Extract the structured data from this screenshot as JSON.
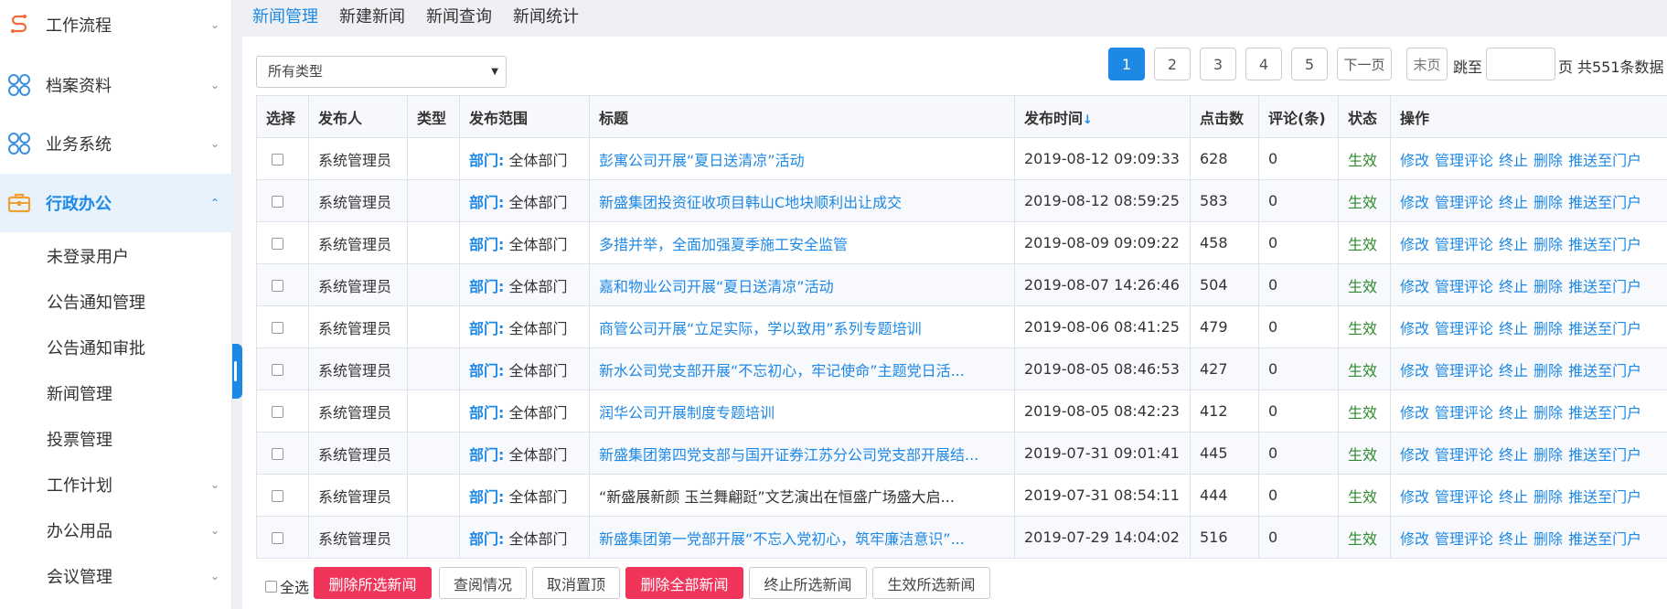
{
  "sidebar": {
    "groups": [
      {
        "label": "工作流程",
        "icon": "workflow-icon"
      },
      {
        "label": "档案资料",
        "icon": "archive-icon"
      },
      {
        "label": "业务系统",
        "icon": "business-system-icon"
      },
      {
        "label": "行政办公",
        "icon": "briefcase-icon"
      }
    ],
    "sub_items": [
      {
        "label": "未登录用户"
      },
      {
        "label": "公告通知管理"
      },
      {
        "label": "公告通知审批"
      },
      {
        "label": "新闻管理"
      },
      {
        "label": "投票管理"
      },
      {
        "label": "工作计划"
      },
      {
        "label": "办公用品"
      },
      {
        "label": "会议管理"
      }
    ]
  },
  "tabs": [
    {
      "label": "新闻管理"
    },
    {
      "label": "新建新闻"
    },
    {
      "label": "新闻查询"
    },
    {
      "label": "新闻统计"
    }
  ],
  "filter": {
    "type_select": "所有类型"
  },
  "pager": {
    "pages": [
      "1",
      "2",
      "3",
      "4",
      "5"
    ],
    "current": "1",
    "next_label": "下一页",
    "last_label": "末页",
    "jump_label": "跳至",
    "page_unit": "页",
    "total_text": "共551条数据"
  },
  "table": {
    "columns": [
      "选择",
      "发布人",
      "类型",
      "发布范围",
      "标题",
      "发布时间",
      "点击数",
      "评论(条)",
      "状态",
      "操作"
    ],
    "sort_indicator": "↓",
    "dept_prefix": "部门:",
    "actions": [
      "修改",
      "管理评论",
      "终止",
      "删除",
      "推送至门户"
    ],
    "rows": [
      {
        "publisher": "系统管理员",
        "type": "",
        "scope": "全体部门",
        "title": "彭寓公司开展“夏日送清凉”活动",
        "time": "2019-08-12 09:09:33",
        "clicks": "628",
        "comments": "0",
        "status": "生效",
        "link": true
      },
      {
        "publisher": "系统管理员",
        "type": "",
        "scope": "全体部门",
        "title": "新盛集团投资征收项目韩山C地块顺利出让成交",
        "time": "2019-08-12 08:59:25",
        "clicks": "583",
        "comments": "0",
        "status": "生效",
        "link": true
      },
      {
        "publisher": "系统管理员",
        "type": "",
        "scope": "全体部门",
        "title": "多措并举，全面加强夏季施工安全监管",
        "time": "2019-08-09 09:09:22",
        "clicks": "458",
        "comments": "0",
        "status": "生效",
        "link": true
      },
      {
        "publisher": "系统管理员",
        "type": "",
        "scope": "全体部门",
        "title": "嘉和物业公司开展“夏日送清凉”活动",
        "time": "2019-08-07 14:26:46",
        "clicks": "504",
        "comments": "0",
        "status": "生效",
        "link": true
      },
      {
        "publisher": "系统管理员",
        "type": "",
        "scope": "全体部门",
        "title": "商管公司开展“立足实际，学以致用”系列专题培训",
        "time": "2019-08-06 08:41:25",
        "clicks": "479",
        "comments": "0",
        "status": "生效",
        "link": true
      },
      {
        "publisher": "系统管理员",
        "type": "",
        "scope": "全体部门",
        "title": "新水公司党支部开展“不忘初心，牢记使命”主题党日活...",
        "time": "2019-08-05 08:46:53",
        "clicks": "427",
        "comments": "0",
        "status": "生效",
        "link": true
      },
      {
        "publisher": "系统管理员",
        "type": "",
        "scope": "全体部门",
        "title": "润华公司开展制度专题培训",
        "time": "2019-08-05 08:42:23",
        "clicks": "412",
        "comments": "0",
        "status": "生效",
        "link": true
      },
      {
        "publisher": "系统管理员",
        "type": "",
        "scope": "全体部门",
        "title": "新盛集团第四党支部与国开证券江苏分公司党支部开展结...",
        "time": "2019-07-31 09:01:41",
        "clicks": "445",
        "comments": "0",
        "status": "生效",
        "link": true
      },
      {
        "publisher": "系统管理员",
        "type": "",
        "scope": "全体部门",
        "title": "“新盛展新颜 玉兰舞翩跹”文艺演出在恒盛广场盛大启...",
        "time": "2019-07-31 08:54:11",
        "clicks": "444",
        "comments": "0",
        "status": "生效",
        "link": false
      },
      {
        "publisher": "系统管理员",
        "type": "",
        "scope": "全体部门",
        "title": "新盛集团第一党部开展“不忘入党初心，筑牢廉洁意识”...",
        "time": "2019-07-29 14:04:02",
        "clicks": "516",
        "comments": "0",
        "status": "生效",
        "link": true
      }
    ]
  },
  "bottom": {
    "select_all": "全选",
    "buttons": [
      "删除所选新闻",
      "查阅情况",
      "取消置顶",
      "删除全部新闻",
      "终止所选新闻",
      "生效所选新闻"
    ]
  },
  "colors": {
    "accent": "#1e88e5",
    "danger": "#f0345a",
    "status_ok": "#2e8b2e"
  }
}
